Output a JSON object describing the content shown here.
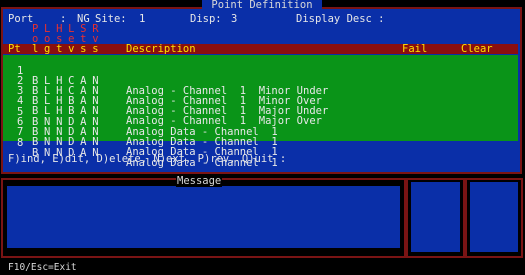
{
  "window": {
    "title": "Point Definition"
  },
  "info": {
    "port_label": "Port",
    "port_value": "NG",
    "site_label": "Site:",
    "site_value": "1",
    "disp_label": "Disp:",
    "disp_value": "3",
    "disp_desc_label": "Display Desc :"
  },
  "col_heads": {
    "line1": "P L H L S R",
    "line2": "o o s e t v",
    "line3": "l g t v s s",
    "pt": "Pt",
    "description": "Description",
    "fail": "Fail",
    "clear": "Clear"
  },
  "rows": [
    {
      "pt": "1",
      "flags": "B L H C A N",
      "desc": "Analog - Channel  1  Minor Under"
    },
    {
      "pt": "2",
      "flags": "B L H C A N",
      "desc": "Analog - Channel  1  Minor Over"
    },
    {
      "pt": "3",
      "flags": "B L H B A N",
      "desc": "Analog - Channel  1  Major Under"
    },
    {
      "pt": "4",
      "flags": "B L H B A N",
      "desc": "Analog - Channel  1  Major Over"
    },
    {
      "pt": "5",
      "flags": "B N N D A N",
      "desc": "Analog Data - Channel  1"
    },
    {
      "pt": "6",
      "flags": "B N N D A N",
      "desc": "Analog Data - Channel  1"
    },
    {
      "pt": "7",
      "flags": "B N N D A N",
      "desc": "Analog Data - Channel  1"
    },
    {
      "pt": "8",
      "flags": "B N N D A N",
      "desc": "Analog Data - Channel  1"
    }
  ],
  "commands": "F)ind, E)dit, D)elete, N)ext, P)rev, Q)uit :",
  "message": {
    "title": "Message"
  },
  "footer": "F10/Esc=Exit",
  "colors": {
    "blue": "#0a2fa8",
    "green": "#0a9418",
    "maroon": "#7a1414",
    "yellow": "#ffe000"
  }
}
